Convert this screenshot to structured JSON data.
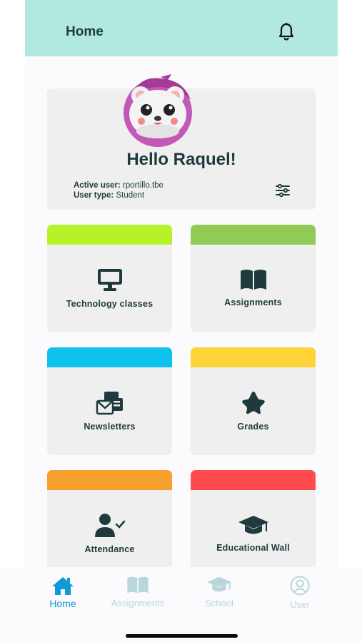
{
  "header": {
    "title": "Home"
  },
  "profile": {
    "greeting": "Hello Raquel!",
    "active_user_label": "Active user:",
    "active_user_value": "rportillo.tbe",
    "user_type_label": "User type:",
    "user_type_value": "Student"
  },
  "tiles": [
    {
      "label": "Technology classes",
      "color": "#b5f229",
      "icon": "monitor-icon"
    },
    {
      "label": "Assignments",
      "color": "#8fcb55",
      "icon": "book-icon"
    },
    {
      "label": "Newsletters",
      "color": "#0fc2ee",
      "icon": "newsletter-icon"
    },
    {
      "label": "Grades",
      "color": "#ffd438",
      "icon": "star-icon"
    },
    {
      "label": "Attendance",
      "color": "#f7a02f",
      "icon": "user-check-icon"
    },
    {
      "label": "Educational Wall",
      "color": "#ff4b4f",
      "icon": "graduation-cap-icon"
    }
  ],
  "nav": [
    {
      "label": "Home",
      "icon": "home-icon",
      "active": true
    },
    {
      "label": "Assignments",
      "icon": "book-icon",
      "active": false
    },
    {
      "label": "School",
      "icon": "graduation-cap-icon",
      "active": false
    },
    {
      "label": "User",
      "icon": "user-circle-icon",
      "active": false
    }
  ],
  "colors": {
    "header_bg": "#b1e9e1",
    "text_dark": "#1f3a3d",
    "nav_active": "#0f9ad6",
    "nav_inactive": "#b9d6dc"
  }
}
